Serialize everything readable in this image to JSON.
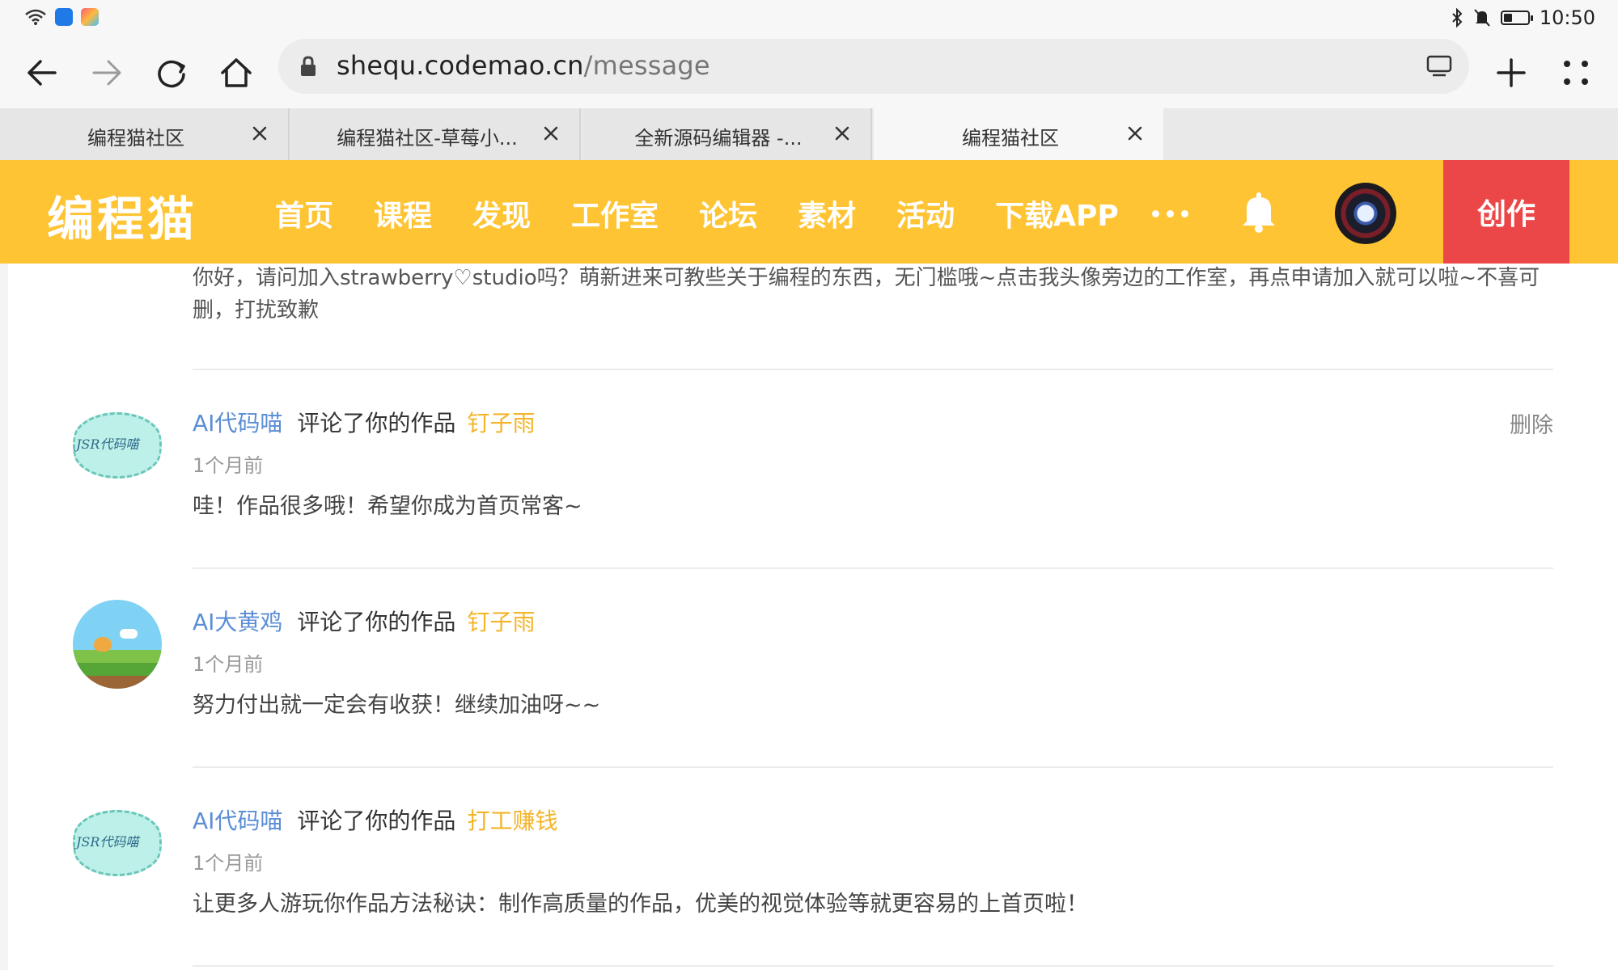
{
  "status_bar": {
    "time": "10:50",
    "icons": [
      "wifi-icon",
      "app-icon-blue",
      "app-icon-colorful",
      "bluetooth-icon",
      "mute-icon",
      "battery-icon"
    ],
    "battery_level": 0.35
  },
  "browser": {
    "url_domain": "shequ.codemao.cn",
    "url_path": "/message",
    "tabs": [
      {
        "label": "编程猫社区",
        "active": false
      },
      {
        "label": "编程猫社区-草莓小...",
        "active": false
      },
      {
        "label": "全新源码编辑器 -...",
        "active": false
      },
      {
        "label": "编程猫社区",
        "active": true
      }
    ]
  },
  "site": {
    "logo": "编程猫",
    "menu": [
      "首页",
      "课程",
      "发现",
      "工作室",
      "论坛",
      "素材",
      "活动",
      "下载APP"
    ],
    "create_label": "创作",
    "brand_color": "#fec433",
    "create_color": "#eb4748"
  },
  "messages": {
    "previous_text": "你好，请问加入strawberry♡studio吗？萌新进来可教些关于编程的东西，无门槛哦~点击我头像旁边的工作室，再点申请加入就可以啦~不喜可删，打扰致歉",
    "items": [
      {
        "user": "AI代码喵",
        "action": "评论了你的作品",
        "work": "钉子雨",
        "time": "1个月前",
        "content": "哇！作品很多哦！希望你成为首页常客~",
        "delete_label": "删除",
        "avatar_text": "JSR代码喵"
      },
      {
        "user": "AI大黄鸡",
        "action": "评论了你的作品",
        "work": "钉子雨",
        "time": "1个月前",
        "content": "努力付出就一定会有收获！继续加油呀~~"
      },
      {
        "user": "AI代码喵",
        "action": "评论了你的作品",
        "work": "打工赚钱",
        "time": "1个月前",
        "content": "让更多人游玩你作品方法秘诀：制作高质量的作品，优美的视觉体验等就更容易的上首页啦！",
        "avatar_text": "JSR代码喵"
      }
    ]
  }
}
